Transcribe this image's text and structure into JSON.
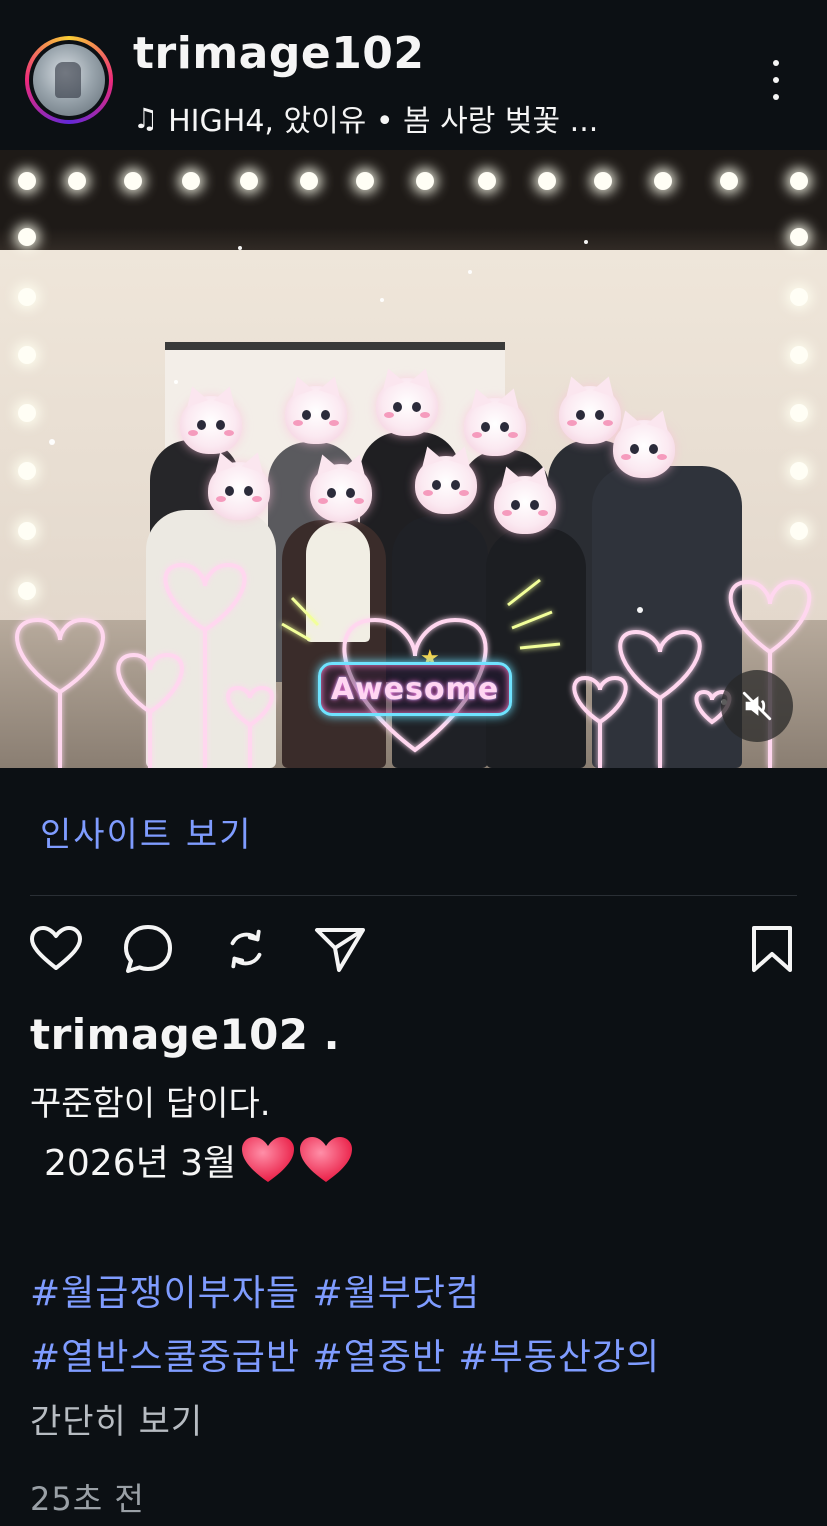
{
  "header": {
    "username": "trimage102",
    "music": "HIGH4, 았이유 • 봄 사랑 벚꽃 ...",
    "music_icon": "music-note-icon",
    "more_icon": "more-vertical-icon"
  },
  "media": {
    "sticker_text": "Awesome",
    "muted": true,
    "mute_icon": "speaker-muted-icon"
  },
  "insights_label": "인사이트 보기",
  "actions": {
    "like_icon": "heart-outline-icon",
    "comment_icon": "comment-bubble-icon",
    "repost_icon": "repost-icon",
    "share_icon": "send-paper-plane-icon",
    "save_icon": "bookmark-icon"
  },
  "caption": {
    "username": "trimage102 .",
    "line1": "꾸준함이 답이다.",
    "line2": "2026년 3월",
    "hashtags_line1": "#월급쟁이부자들 #월부닷컴",
    "hashtags_line2": "#열반스쿨중급반 #열중반 #부동산강의",
    "more": "간단히 보기",
    "timestamp": "25초 전"
  },
  "colors": {
    "background": "#0c1014",
    "link": "#7f9cff",
    "heart_emoji": "#ff2d55"
  }
}
